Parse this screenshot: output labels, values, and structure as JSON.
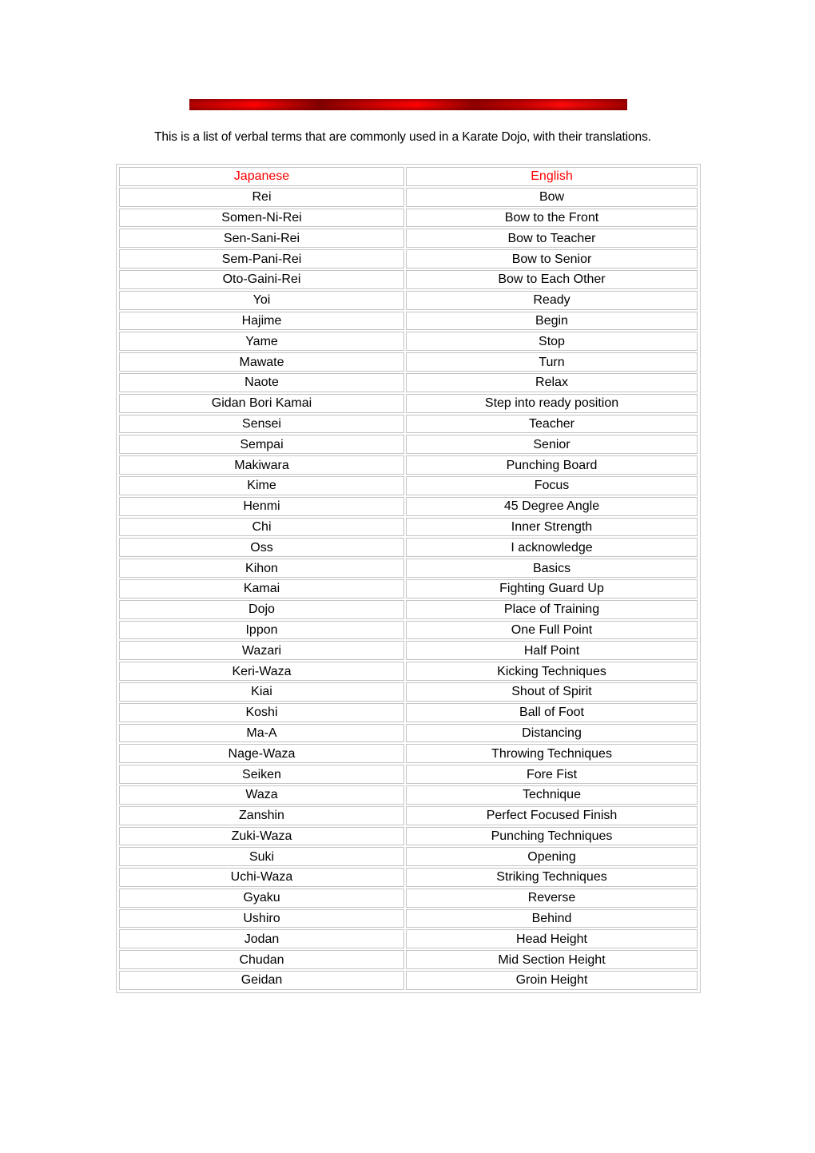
{
  "banner": {
    "name": "decorative-red-bar",
    "color": "#e00000"
  },
  "intro": "This is a list of verbal terms that are commonly used in a Karate Dojo, with their translations.",
  "table": {
    "header_color": "#ff0000",
    "headers": [
      "Japanese",
      "English"
    ],
    "rows": [
      [
        "Rei",
        "Bow"
      ],
      [
        "Somen-Ni-Rei",
        "Bow to the Front"
      ],
      [
        "Sen-Sani-Rei",
        "Bow to Teacher"
      ],
      [
        "Sem-Pani-Rei",
        "Bow to Senior"
      ],
      [
        "Oto-Gaini-Rei",
        "Bow to Each Other"
      ],
      [
        "Yoi",
        "Ready"
      ],
      [
        "Hajime",
        "Begin"
      ],
      [
        "Yame",
        "Stop"
      ],
      [
        "Mawate",
        "Turn"
      ],
      [
        "Naote",
        "Relax"
      ],
      [
        "Gidan Bori Kamai",
        "Step into ready position"
      ],
      [
        "Sensei",
        "Teacher"
      ],
      [
        "Sempai",
        "Senior"
      ],
      [
        "Makiwara",
        "Punching Board"
      ],
      [
        "Kime",
        "Focus"
      ],
      [
        "Henmi",
        "45 Degree Angle"
      ],
      [
        "Chi",
        "Inner Strength"
      ],
      [
        "Oss",
        "I acknowledge"
      ],
      [
        "Kihon",
        "Basics"
      ],
      [
        "Kamai",
        "Fighting Guard Up"
      ],
      [
        "Dojo",
        "Place of Training"
      ],
      [
        "Ippon",
        "One Full Point"
      ],
      [
        "Wazari",
        "Half Point"
      ],
      [
        "Keri-Waza",
        "Kicking Techniques"
      ],
      [
        "Kiai",
        "Shout of Spirit"
      ],
      [
        "Koshi",
        "Ball of Foot"
      ],
      [
        "Ma-A",
        "Distancing"
      ],
      [
        "Nage-Waza",
        "Throwing Techniques"
      ],
      [
        "Seiken",
        "Fore Fist"
      ],
      [
        "Waza",
        "Technique"
      ],
      [
        "Zanshin",
        "Perfect Focused Finish"
      ],
      [
        "Zuki-Waza",
        "Punching Techniques"
      ],
      [
        "Suki",
        "Opening"
      ],
      [
        "Uchi-Waza",
        "Striking Techniques"
      ],
      [
        "Gyaku",
        "Reverse"
      ],
      [
        "Ushiro",
        "Behind"
      ],
      [
        "Jodan",
        "Head Height"
      ],
      [
        "Chudan",
        "Mid Section Height"
      ],
      [
        "Geidan",
        "Groin Height"
      ]
    ]
  }
}
